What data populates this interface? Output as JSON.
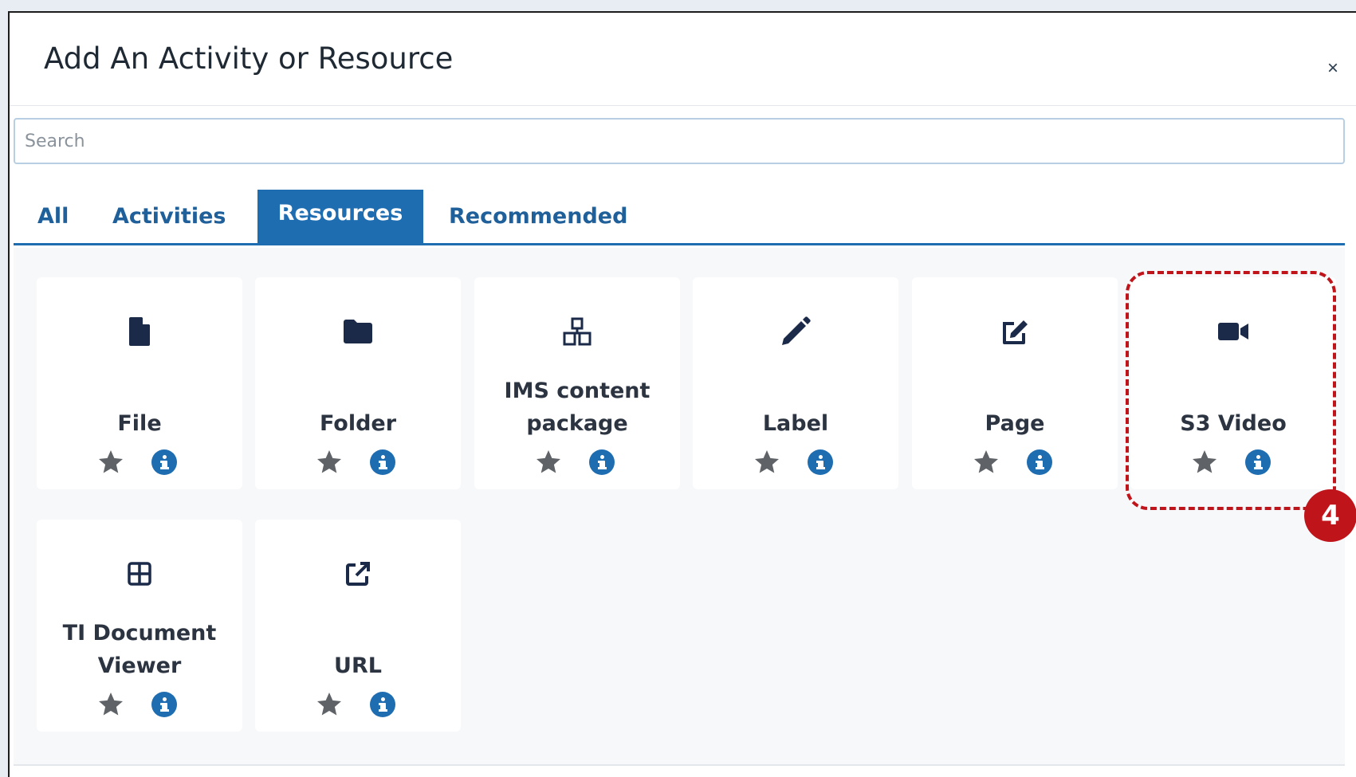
{
  "modal": {
    "title": "Add An Activity or Resource",
    "close_label": "×"
  },
  "search": {
    "placeholder": "Search",
    "value": ""
  },
  "tabs": [
    {
      "label": "All",
      "active": false
    },
    {
      "label": "Activities",
      "active": false
    },
    {
      "label": "Resources",
      "active": true
    },
    {
      "label": "Recommended",
      "active": false
    }
  ],
  "items": [
    {
      "label": "File",
      "icon": "file-icon"
    },
    {
      "label": "Folder",
      "icon": "folder-icon"
    },
    {
      "label": "IMS content package",
      "icon": "package-icon"
    },
    {
      "label": "Label",
      "icon": "pencil-icon"
    },
    {
      "label": "Page",
      "icon": "edit-icon"
    },
    {
      "label": "S3 Video",
      "icon": "video-icon"
    },
    {
      "label": "TI Document Viewer",
      "icon": "grid-icon"
    },
    {
      "label": "URL",
      "icon": "external-link-icon"
    }
  ],
  "annotation": {
    "step_number": "4"
  },
  "colors": {
    "accent": "#1f6db1",
    "highlight": "#c0141b",
    "icon": "#1a2a48",
    "star": "#5f6368"
  }
}
